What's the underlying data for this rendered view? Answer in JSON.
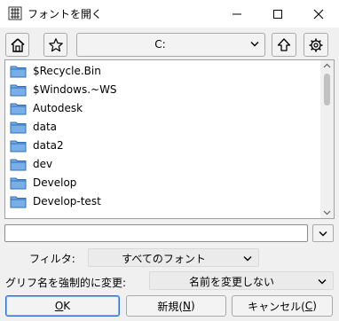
{
  "window": {
    "title": "フォントを開く",
    "app_icon": "font-app-icon",
    "controls": [
      "minimize-icon",
      "maximize-icon",
      "close-icon"
    ]
  },
  "toolbar": {
    "home_icon": "home-icon",
    "favorite_icon": "star-icon",
    "drive": "C:",
    "up_icon": "up-arrow-icon",
    "settings_icon": "gear-icon"
  },
  "file_list": {
    "items": [
      {
        "name": "$Recycle.Bin",
        "icon": "folder-icon"
      },
      {
        "name": "$Windows.~WS",
        "icon": "folder-icon"
      },
      {
        "name": "Autodesk",
        "icon": "folder-icon"
      },
      {
        "name": "data",
        "icon": "folder-icon"
      },
      {
        "name": "data2",
        "icon": "folder-icon"
      },
      {
        "name": "dev",
        "icon": "folder-icon"
      },
      {
        "name": "Develop",
        "icon": "folder-icon"
      },
      {
        "name": "Develop-test",
        "icon": "folder-icon"
      }
    ]
  },
  "path_input": {
    "value": ""
  },
  "filter": {
    "label": "フィルタ:",
    "value": "すべてのフォント"
  },
  "glyph_rename": {
    "label": "グリフ名を強制的に変更:",
    "value": "名前を変更しない"
  },
  "buttons": {
    "ok": "OK",
    "ok_mnemonic": "O",
    "ok_rest": "K",
    "new_prefix": "新規(",
    "new_mnemonic": "N",
    "new_suffix": ")",
    "cancel_prefix": "キャンセル(",
    "cancel_mnemonic": "C",
    "cancel_suffix": ")"
  },
  "colors": {
    "folder": "#7aaee6",
    "folder_edge": "#2f6fb7",
    "accent": "#2b6fd1"
  }
}
